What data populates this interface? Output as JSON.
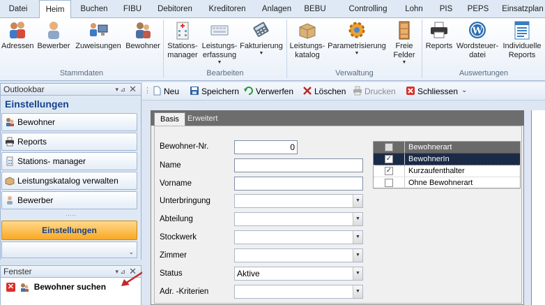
{
  "menu": {
    "tabs": [
      "Datei",
      "Heim",
      "Buchen",
      "FIBU",
      "Debitoren",
      "Kreditoren",
      "Anlagen",
      "BEBU",
      "Controlling",
      "Lohn",
      "PIS",
      "PEPS",
      "Einsatzplan"
    ],
    "active": "Heim"
  },
  "ribbon": {
    "buttons": [
      {
        "label": "Adressen",
        "icon": "people-icon"
      },
      {
        "label": "Bewerber",
        "icon": "person-icon"
      },
      {
        "label": "Zuweisungen",
        "icon": "users-computer-icon"
      },
      {
        "label": "Bewohner",
        "icon": "resident-icon"
      },
      {
        "label": "Stations-\nmanager",
        "icon": "building-icon"
      },
      {
        "label": "Leistungs-\nerfassung",
        "icon": "keyboard-icon"
      },
      {
        "label": "Fakturierung",
        "icon": "calculator-icon"
      },
      {
        "label": "Leistungs-\nkatalog",
        "icon": "box-icon"
      },
      {
        "label": "Parametrisierung",
        "icon": "gear-icon"
      },
      {
        "label": "Freie\nFelder",
        "icon": "cabinet-icon"
      },
      {
        "label": "Reports",
        "icon": "printer-icon"
      },
      {
        "label": "Wordsteuer-\ndatei",
        "icon": "wordpress-icon"
      },
      {
        "label": "Individuelle\nReports",
        "icon": "report-list-icon"
      }
    ],
    "groups": [
      "Stammdaten",
      "Bearbeiten",
      "Verwaltung",
      "Auswertungen"
    ]
  },
  "outlookbar": {
    "title": "Outlookbar",
    "pin": "▼ 📌",
    "close": "✕",
    "header": "Einstellungen",
    "items": [
      "Bewohner",
      "Reports",
      "Stations- manager",
      "Leistungskatalog verwalten",
      "Bewerber"
    ],
    "dots": "·····",
    "active_section": "Einstellungen",
    "chevron": "⌄"
  },
  "fenster": {
    "title": "Fenster",
    "item": "Bewohner suchen"
  },
  "toolbar": {
    "buttons": [
      {
        "label": "Neu",
        "icon": "new-doc-icon",
        "enabled": true
      },
      {
        "label": "Speichern",
        "icon": "save-icon",
        "enabled": true
      },
      {
        "label": "Verwerfen",
        "icon": "undo-icon",
        "enabled": true
      },
      {
        "label": "Löschen",
        "icon": "delete-icon",
        "enabled": true
      },
      {
        "label": "Drucken",
        "icon": "print-icon",
        "enabled": false
      },
      {
        "label": "Schliessen",
        "icon": "close-icon",
        "enabled": true
      }
    ],
    "overflow": "⌄"
  },
  "form": {
    "tabs": [
      "Basis",
      "Erweitert"
    ],
    "active_tab": "Basis",
    "fields": [
      {
        "label": "Bewohner-Nr.",
        "type": "number",
        "value": "0"
      },
      {
        "label": "Name",
        "type": "text",
        "value": ""
      },
      {
        "label": "Vorname",
        "type": "text",
        "value": ""
      },
      {
        "label": "Unterbringung",
        "type": "select",
        "value": ""
      },
      {
        "label": "Abteilung",
        "type": "select",
        "value": ""
      },
      {
        "label": "Stockwerk",
        "type": "select",
        "value": ""
      },
      {
        "label": "Zimmer",
        "type": "select",
        "value": ""
      },
      {
        "label": "Status",
        "type": "select",
        "value": "Aktive"
      },
      {
        "label": "Adr. -Kriterien",
        "type": "select",
        "value": ""
      }
    ]
  },
  "grid": {
    "header": "Bewohnerart",
    "rows": [
      {
        "label": "BewohnerIn",
        "checked": true,
        "selected": true
      },
      {
        "label": "Kurzaufenthalter",
        "checked": true,
        "selected": false
      },
      {
        "label": "Ohne Bewohnerart",
        "checked": false,
        "selected": false
      }
    ]
  },
  "colors": {
    "accent": "#15428b",
    "active_orange": "#f9a825",
    "selected_row": "#1b2a46",
    "arrow": "#c0282a"
  }
}
